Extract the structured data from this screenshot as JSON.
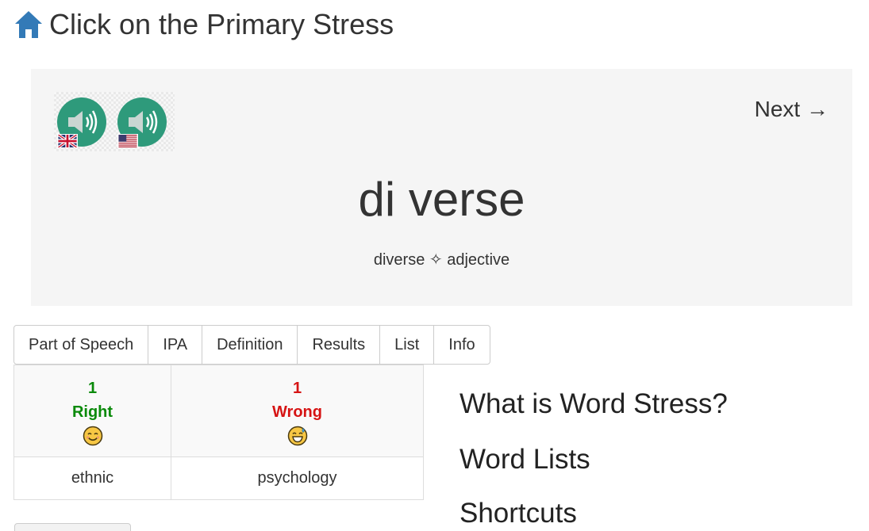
{
  "header": {
    "home_icon": "home-icon",
    "title": "Click on the Primary Stress"
  },
  "card": {
    "audio": [
      {
        "accent": "UK",
        "icon": "speaker-icon",
        "flag": "uk-flag-icon"
      },
      {
        "accent": "US",
        "icon": "speaker-icon",
        "flag": "us-flag-icon"
      }
    ],
    "next_label": "Next →",
    "word_syllables": "di verse",
    "word": "diverse",
    "separator": "✧",
    "part_of_speech": "adjective"
  },
  "tabs": [
    "Part of Speech",
    "IPA",
    "Definition",
    "Results",
    "List",
    "Info"
  ],
  "results": {
    "right": {
      "count": "1",
      "label": "Right",
      "emoji": "smiling-face-icon",
      "words": [
        "ethnic"
      ]
    },
    "wrong": {
      "count": "1",
      "label": "Wrong",
      "emoji": "grinning-sweat-face-icon",
      "words": [
        "psychology"
      ]
    }
  },
  "side_links": [
    "What is Word Stress?",
    "Word Lists",
    "Shortcuts"
  ],
  "colors": {
    "card_bg": "#f5f5f5",
    "speaker": "#2e9a7b",
    "right": "#0a8a0a",
    "wrong": "#d61414",
    "home": "#337ab7"
  }
}
